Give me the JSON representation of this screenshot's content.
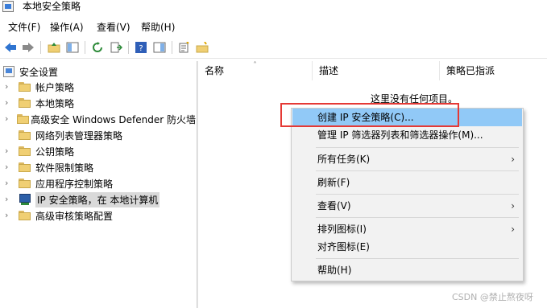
{
  "window": {
    "title": "本地安全策略"
  },
  "menubar": {
    "items": [
      "文件(F)",
      "操作(A)",
      "查看(V)",
      "帮助(H)"
    ]
  },
  "tree": {
    "root": "安全设置",
    "items": [
      {
        "label": "帐户策略"
      },
      {
        "label": "本地策略"
      },
      {
        "label": "高级安全 Windows Defender 防火墙"
      },
      {
        "label": "网络列表管理器策略"
      },
      {
        "label": "公钥策略"
      },
      {
        "label": "软件限制策略"
      },
      {
        "label": "应用程序控制策略"
      },
      {
        "label": "IP 安全策略，在 本地计算机"
      },
      {
        "label": "高级审核策略配置"
      }
    ]
  },
  "list": {
    "columns": [
      "名称",
      "描述",
      "策略已指派"
    ],
    "empty_message": "这里没有任何项目。"
  },
  "context_menu": {
    "items": [
      "创建 IP 安全策略(C)...",
      "管理 IP 筛选器列表和筛选器操作(M)...",
      "所有任务(K)",
      "刷新(F)",
      "查看(V)",
      "排列图标(I)",
      "对齐图标(E)",
      "帮助(H)"
    ]
  },
  "watermark": "CSDN @禁止熬夜呀",
  "colors": {
    "highlight": "#91c9f7",
    "annotation_box": "#e53935",
    "menu_bg": "#f2f2f2"
  }
}
